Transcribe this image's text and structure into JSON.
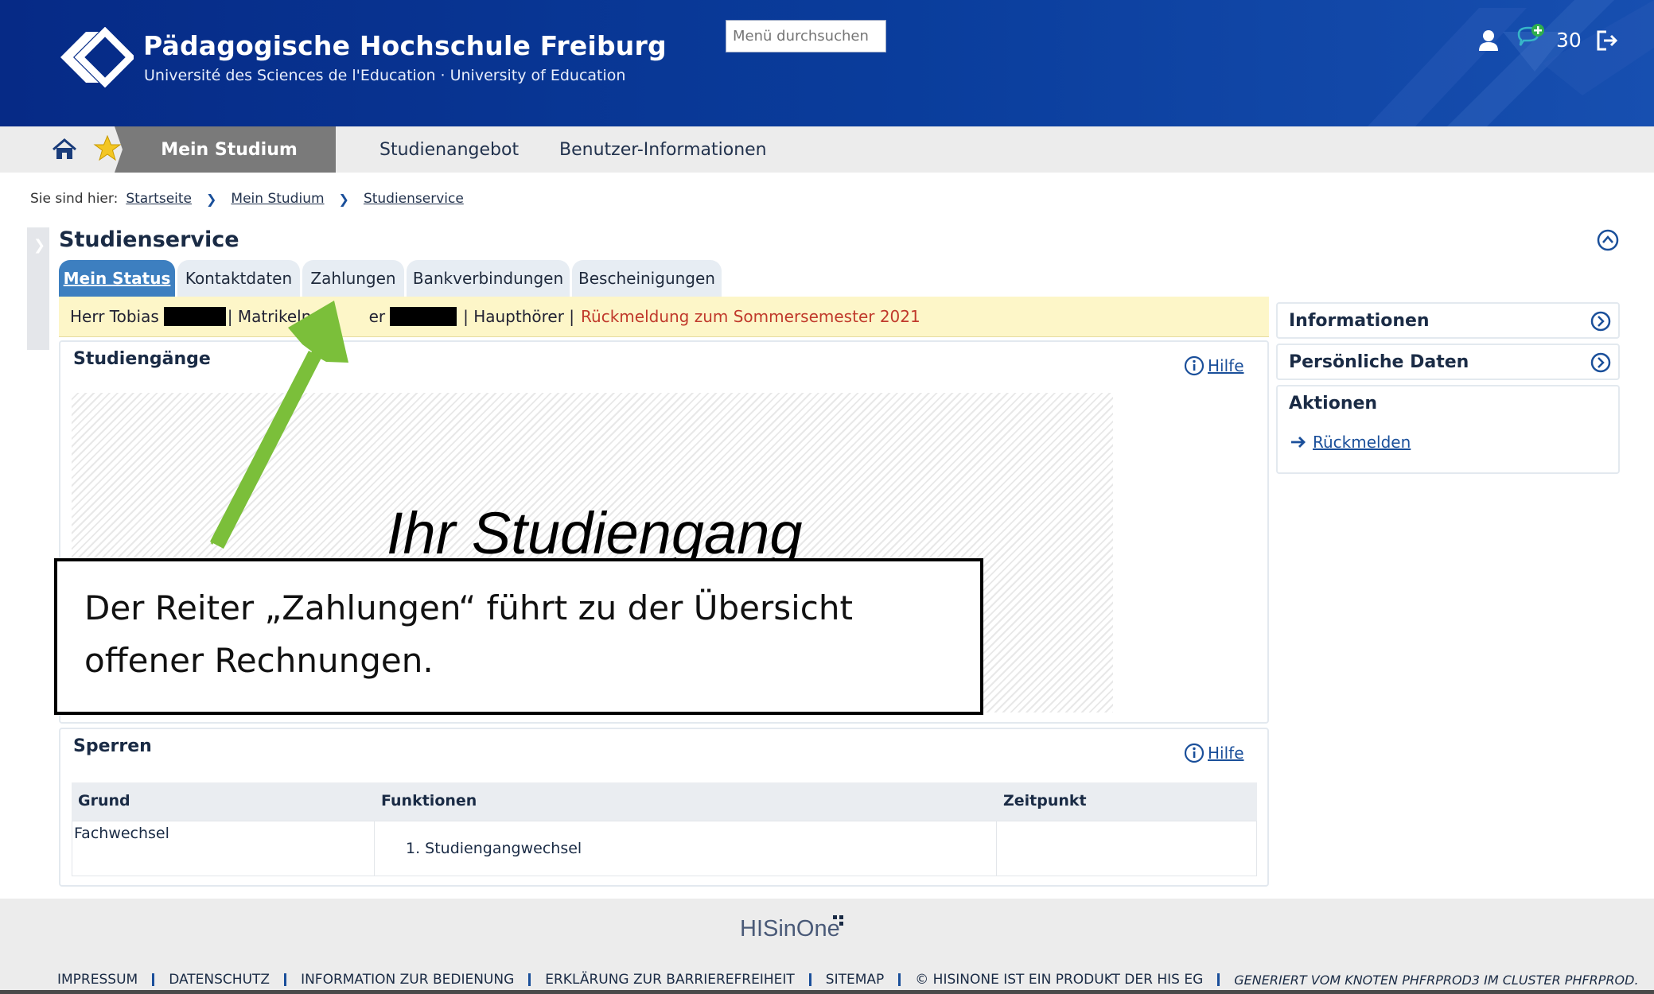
{
  "header": {
    "title": "Pädagogische Hochschule Freiburg",
    "subtitle": "Université des Sciences de l'Education · University of Education",
    "search_placeholder": "Menü durchsuchen",
    "counter": "30",
    "icons": [
      "user-icon",
      "chat-add-icon",
      "logout-icon"
    ]
  },
  "nav": {
    "active": "Mein Studium",
    "items": [
      "Studienangebot",
      "Benutzer-Informationen"
    ],
    "icons": [
      "home-icon",
      "star-icon"
    ]
  },
  "breadcrumb": {
    "label": "Sie sind hier:",
    "items": [
      "Startseite",
      "Mein Studium",
      "Studienservice"
    ]
  },
  "page": {
    "title": "Studienservice"
  },
  "tabs": [
    "Mein Status",
    "Kontaktdaten",
    "Zahlungen",
    "Bankverbindungen",
    "Bescheinigungen"
  ],
  "status": {
    "name": "Herr Tobias",
    "matrikel_label_a": "| Matrikelnum",
    "matrikel_label_b": "er",
    "role": "| Haupthörer |",
    "notice": "Rückmeldung zum Sommersemester 2021"
  },
  "studiengaenge": {
    "title": "Studiengänge",
    "help": "Hilfe",
    "overlay": "Ihr Studiengang"
  },
  "annotation": {
    "line1": "Der Reiter „Zahlungen“ führt zu der Übersicht",
    "line2": "offener Rechnungen."
  },
  "sperren": {
    "title": "Sperren",
    "help": "Hilfe",
    "columns": [
      "Grund",
      "Funktionen",
      "Zeitpunkt"
    ],
    "rows": [
      {
        "grund": "Fachwechsel",
        "funktion": "1. Studiengangwechsel",
        "zeitpunkt": ""
      }
    ]
  },
  "sidebar": {
    "informationen": "Informationen",
    "persoenliche_daten": "Persönliche Daten",
    "aktionen": "Aktionen",
    "action_link": "Rückmelden"
  },
  "footer": {
    "logo": "HISinOne",
    "links": [
      "IMPRESSUM",
      "DATENSCHUTZ",
      "INFORMATION ZUR BEDIENUNG",
      "ERKLÄRUNG ZUR BARRIEREFREIHEIT",
      "SITEMAP",
      "© HISINONE IST EIN PRODUKT DER HIS EG"
    ],
    "generated": "GENERIERT VOM KNOTEN PHFRPROD3 IM CLUSTER PHFRPROD."
  },
  "colors": {
    "header_blue": "#0a3d9c",
    "tab_active": "#3d7fc0",
    "status_bg": "#fdf6c8",
    "notice_red": "#c0392b",
    "arrow_green": "#7bbf3a"
  }
}
